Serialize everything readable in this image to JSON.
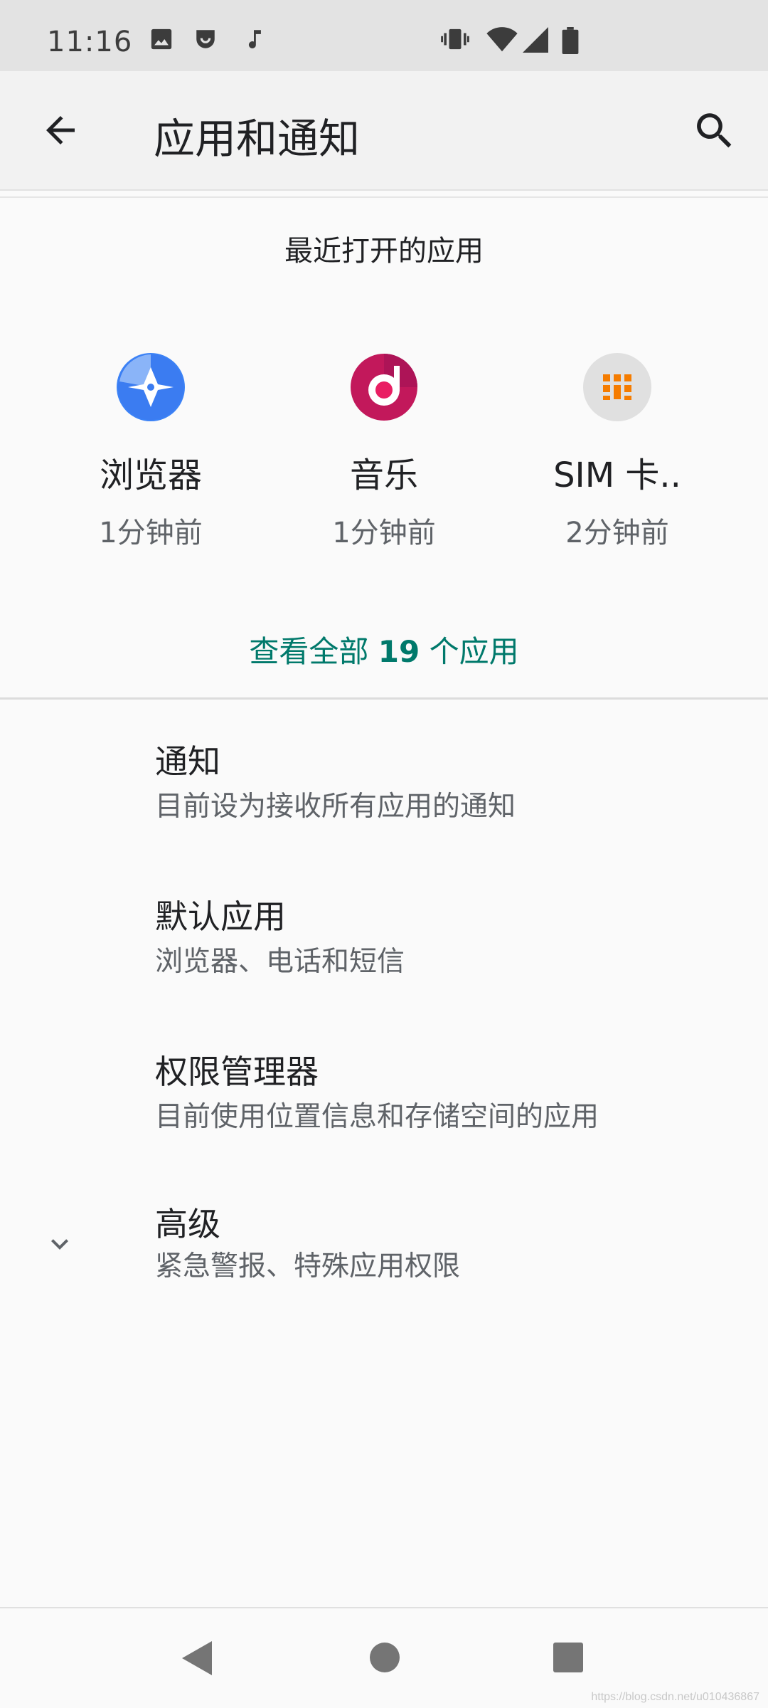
{
  "status_bar": {
    "time": "11:16",
    "left_icons": [
      "image-icon",
      "smiley-badge-icon",
      "music-note-icon"
    ],
    "right_icons": [
      "vibrate-icon",
      "wifi-icon",
      "cell-signal-icon",
      "battery-icon"
    ]
  },
  "app_bar": {
    "title": "应用和通知",
    "back_icon": "arrow-back-icon",
    "search_icon": "search-icon"
  },
  "recent": {
    "header": "最近打开的应用",
    "apps": [
      {
        "name": "浏览器",
        "time": "1分钟前",
        "icon": "browser-icon",
        "color": "#3b82f6"
      },
      {
        "name": "音乐",
        "time": "1分钟前",
        "icon": "music-app-icon",
        "color": "#c2185b"
      },
      {
        "name": "SIM 卡..",
        "time": "2分钟前",
        "icon": "sim-card-icon",
        "color": "#f57c00"
      }
    ],
    "see_all": {
      "prefix": "查看全部 ",
      "count": "19",
      "suffix": " 个应用"
    }
  },
  "prefs": [
    {
      "title": "通知",
      "summary": "目前设为接收所有应用的通知"
    },
    {
      "title": "默认应用",
      "summary": "浏览器、电话和短信"
    },
    {
      "title": "权限管理器",
      "summary": "目前使用位置信息和存储空间的应用"
    },
    {
      "title": "高级",
      "summary": "紧急警报、特殊应用权限",
      "icon": "chevron-down-icon"
    }
  ],
  "nav_bar": {
    "back": "nav-back-icon",
    "home": "nav-home-icon",
    "recents": "nav-recents-icon"
  },
  "watermark": "https://blog.csdn.net/u010436867"
}
